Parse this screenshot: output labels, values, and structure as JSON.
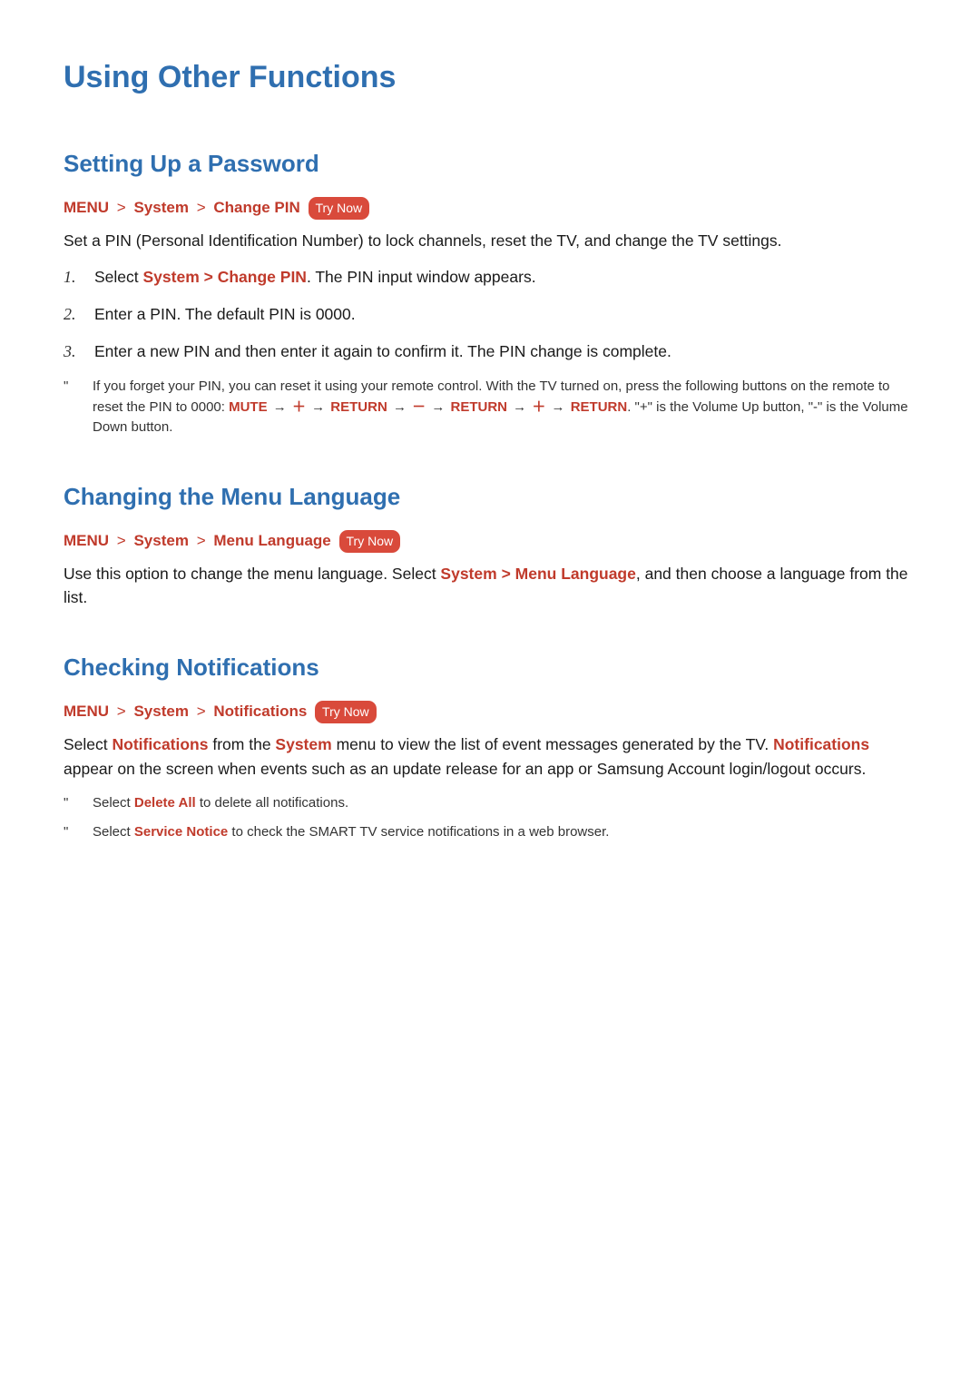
{
  "title": "Using Other Functions",
  "sections": {
    "password": {
      "heading": "Setting Up a Password",
      "crumb": {
        "m": "MENU",
        "s": "System",
        "leaf": "Change PIN",
        "try": "Try Now"
      },
      "intro": "Set a PIN (Personal Identification Number) to lock channels, reset the TV, and change the TV settings.",
      "step1_pre": "Select ",
      "step1_s": "System",
      "step1_cp": "Change PIN",
      "step1_post": ". The PIN input window appears.",
      "step2": "Enter a PIN. The default PIN is 0000.",
      "step3": "Enter a new PIN and then enter it again to confirm it. The PIN change is complete.",
      "note_a": "If you forget your PIN, you can reset it using your remote control. With the TV turned on, press the following buttons on the remote to reset the PIN to 0000: ",
      "mute": "MUTE",
      "ret": "RETURN",
      "plus": "＋",
      "minus": "－",
      "note_b": ". \"+\" is the Volume Up button, \"-\" is the Volume Down button."
    },
    "lang": {
      "heading": "Changing the Menu Language",
      "crumb": {
        "m": "MENU",
        "s": "System",
        "leaf": "Menu Language",
        "try": "Try Now"
      },
      "body_a": "Use this option to change the menu language. Select ",
      "s": "System",
      "ml": "Menu Language",
      "body_b": ", and then choose a language from the list."
    },
    "notif": {
      "heading": "Checking Notifications",
      "crumb": {
        "m": "MENU",
        "s": "System",
        "leaf": "Notifications",
        "try": "Try Now"
      },
      "body_a": "Select ",
      "n": "Notifications",
      "body_b": " from the ",
      "s": "System",
      "body_c": " menu to view the list of event messages generated by the TV. ",
      "n2": "Notifications",
      "body_d": " appear on the screen when events such as an update release for an app or Samsung Account login/logout occurs.",
      "note1_a": "Select ",
      "note1_b": "Delete All",
      "note1_c": " to delete all notifications.",
      "note2_a": "Select ",
      "note2_b": "Service Notice",
      "note2_c": " to check the SMART TV service notifications in a web browser."
    }
  }
}
